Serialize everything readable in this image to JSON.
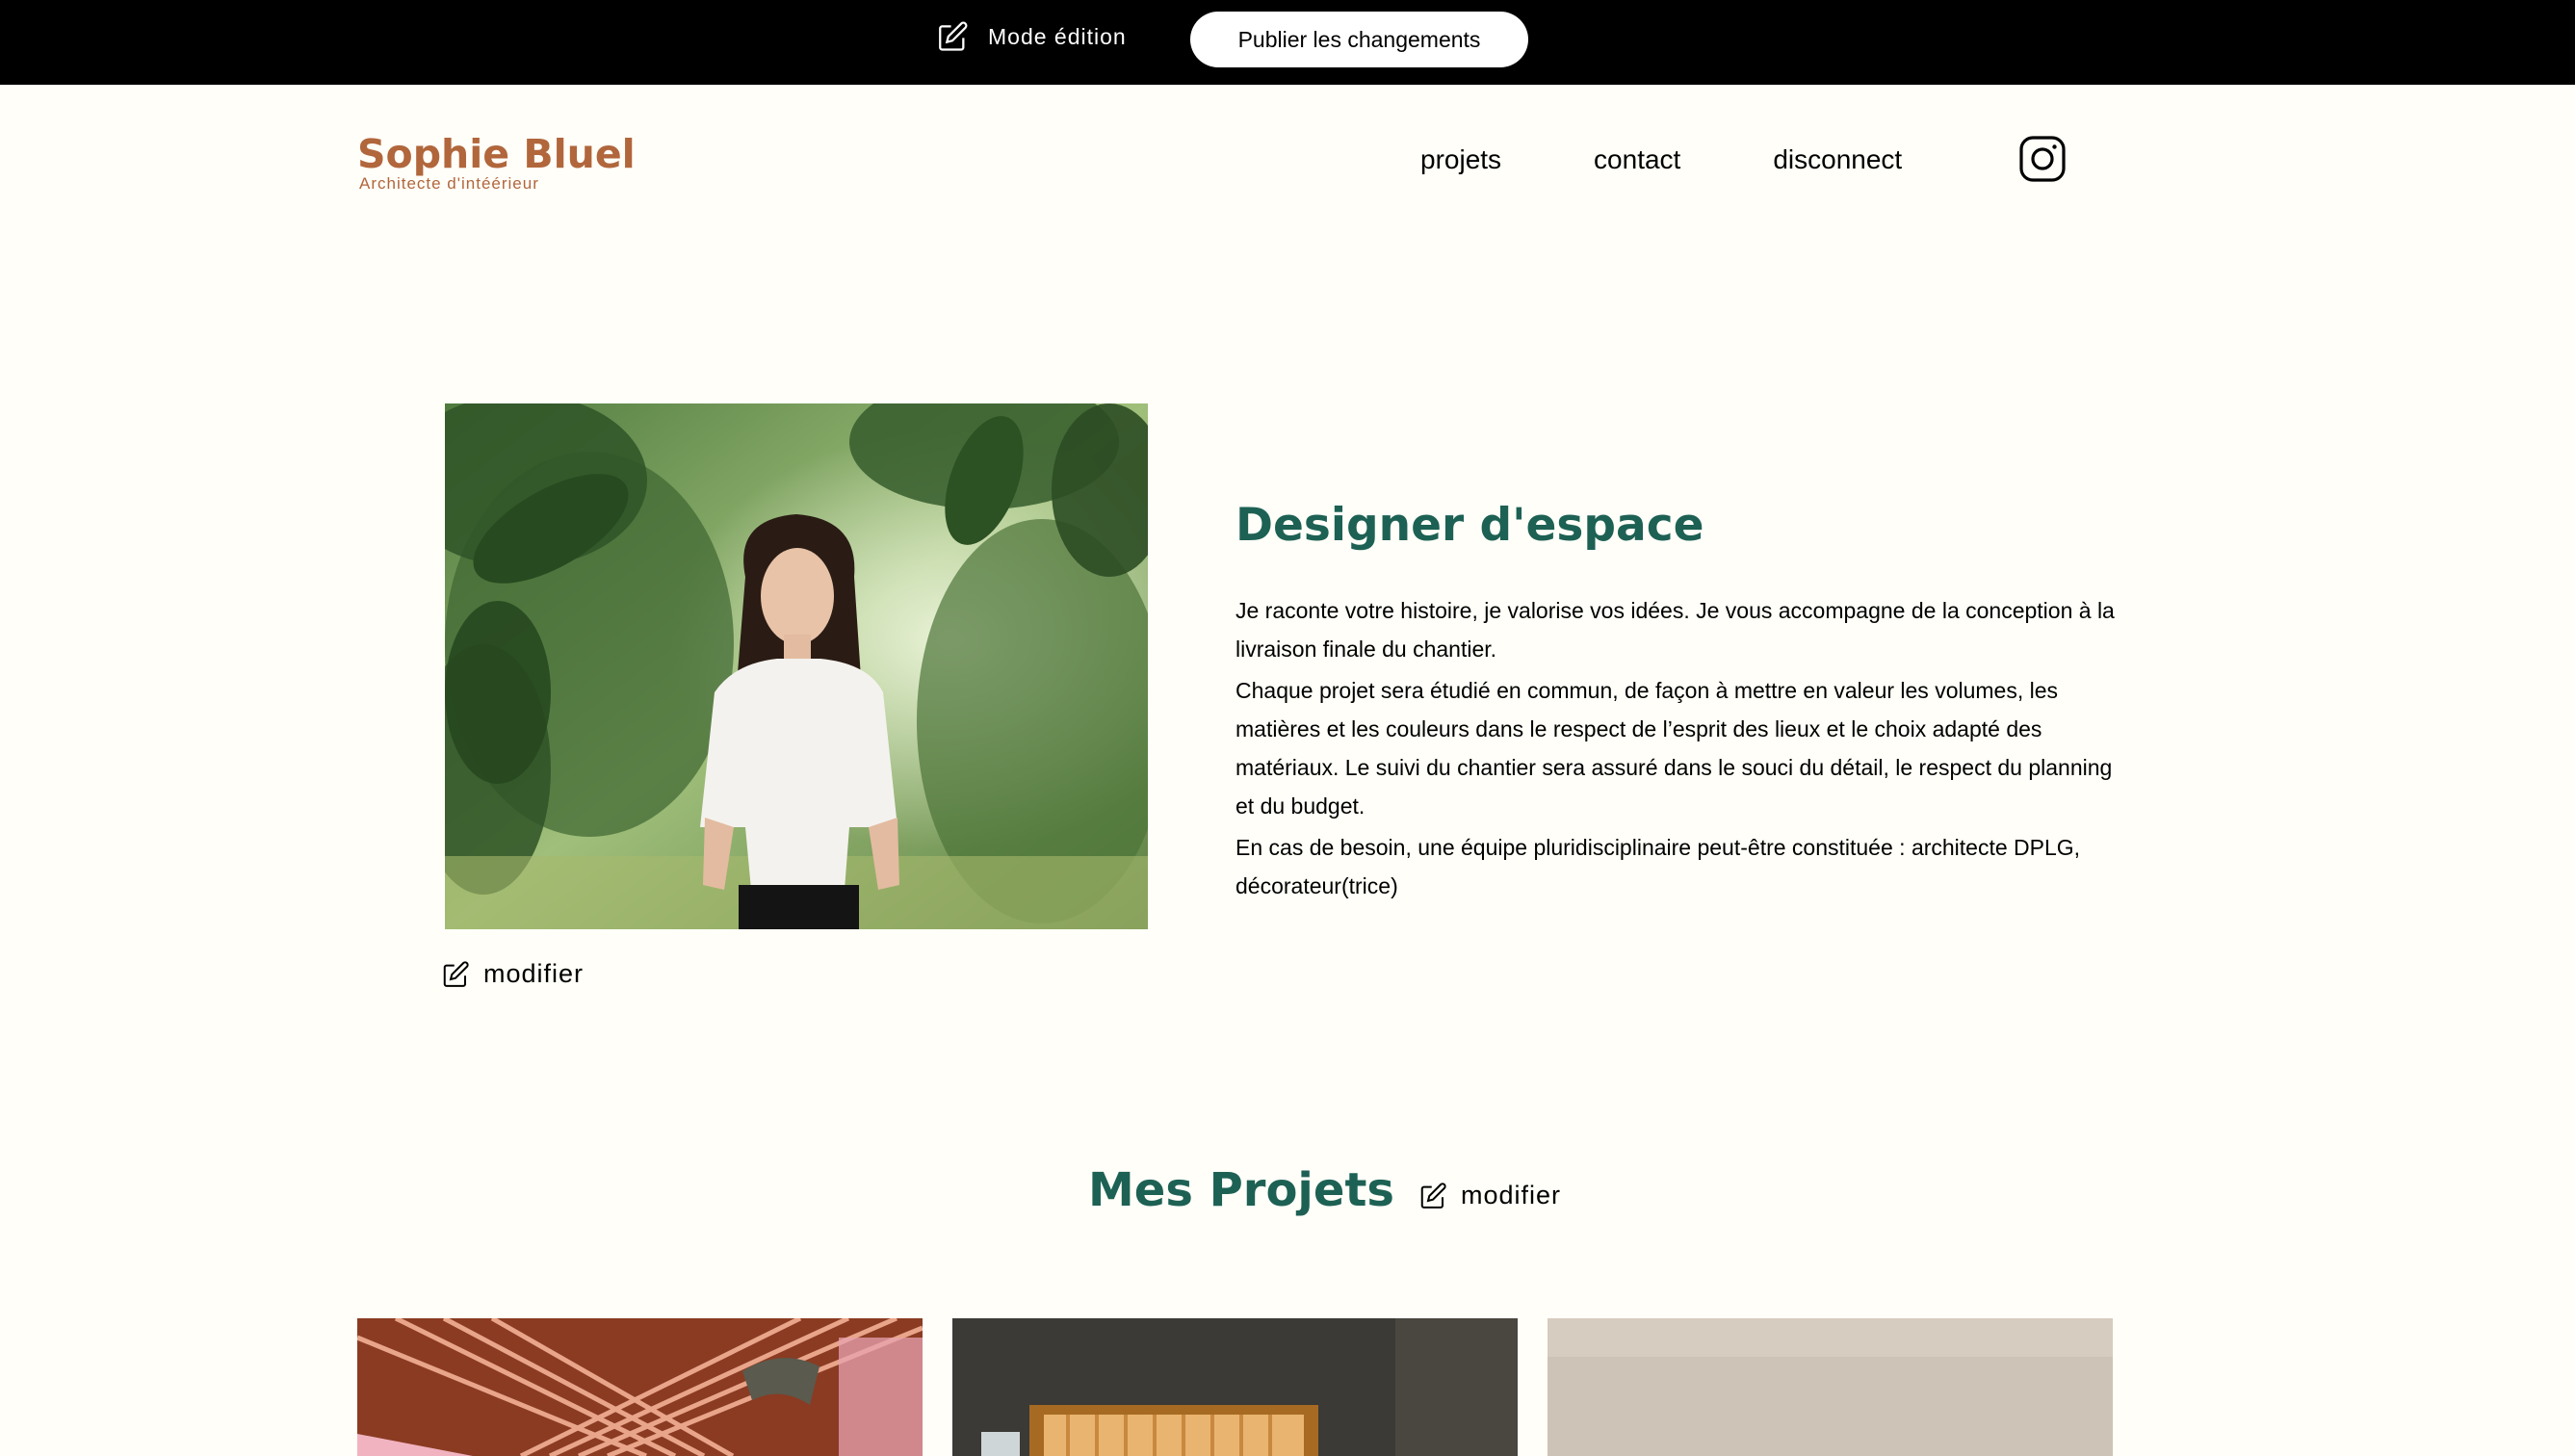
{
  "edit_bar": {
    "mode_label": "Mode édition",
    "publish_label": "Publier les changements"
  },
  "header": {
    "logo_name": "Sophie Bluel",
    "logo_subtitle": "Architecte d'intéérieur",
    "nav": [
      "projets",
      "contact",
      "disconnect"
    ],
    "instagram_icon": "instagram-icon"
  },
  "intro": {
    "modify_label": "modifier",
    "title": "Designer d'espace",
    "paragraphs": [
      "Je raconte votre histoire, je valorise vos idées. Je vous accompagne de la conception à la livraison finale du chantier.",
      "Chaque projet sera étudié en commun, de façon à mettre en valeur les volumes, les matières et les couleurs dans le respect de l’esprit des lieux et le choix adapté des matériaux. Le suivi du chantier sera assuré dans le souci du détail, le respect du planning et du budget.",
      "En cas de besoin, une équipe pluridisciplinaire peut-être constituée : architecte DPLG, décorateur(trice)"
    ]
  },
  "projects": {
    "title": "Mes Projets",
    "modify_label": "modifier"
  },
  "colors": {
    "accent_green": "#1d6154",
    "logo_brown": "#b1663c",
    "background": "#fffef8",
    "bar": "#000000"
  }
}
